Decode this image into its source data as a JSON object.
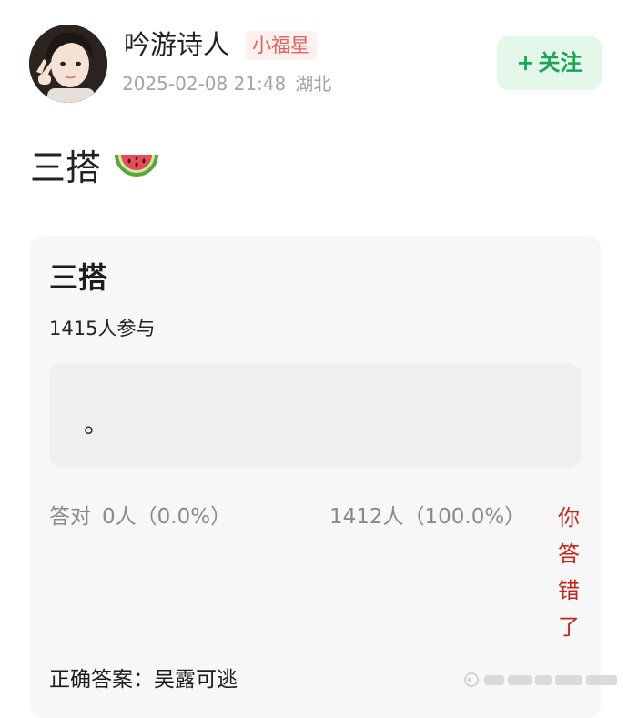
{
  "user": {
    "name": "吟游诗人",
    "badge": "小福星",
    "timestamp": "2025-02-08 21:48",
    "location": "湖北",
    "avatar_icon": "avatar-photo"
  },
  "follow_button": {
    "plus": "+",
    "label": "关注"
  },
  "post": {
    "text": "三搭",
    "emoji_icon": "watermelon-icon"
  },
  "quiz": {
    "title": "三搭",
    "participants": "1415人参与",
    "option_text": "。",
    "correct_label": "答对",
    "correct_count": "0人（0.0%）",
    "wrong_count": "1412人（100.0%）",
    "result": "你答错了",
    "answer": "正确答案：吴露可逃"
  },
  "colors": {
    "accent_green": "#1aa655",
    "follow_bg": "#e3f7ea",
    "badge_red": "#e1605d",
    "wrong_red": "#c8241b",
    "card_bg": "#f7f7f7"
  }
}
